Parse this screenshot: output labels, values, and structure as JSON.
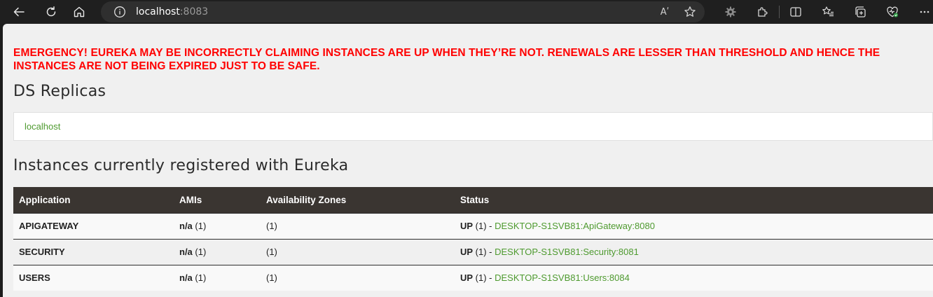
{
  "browser": {
    "url_host": "localhost",
    "url_port": ":8083",
    "read_aloud_icon": "Aʹ"
  },
  "page": {
    "warning": "EMERGENCY! EUREKA MAY BE INCORRECTLY CLAIMING INSTANCES ARE UP WHEN THEY’RE NOT. RENEWALS ARE LESSER THAN THRESHOLD AND HENCE THE INSTANCES ARE NOT BEING EXPIRED JUST TO BE SAFE.",
    "replicas_heading": "DS Replicas",
    "replica_link": "localhost",
    "instances_heading": "Instances currently registered with Eureka",
    "table": {
      "headers": [
        "Application",
        "AMIs",
        "Availability Zones",
        "Status"
      ],
      "rows": [
        {
          "app": "APIGATEWAY",
          "ami_bold": "n/a",
          "ami_count": " (1)",
          "zones": "(1)",
          "status_bold": "UP",
          "status_count": " (1) - ",
          "instance": "DESKTOP-S1SVB81:ApiGateway:8080"
        },
        {
          "app": "SECURITY",
          "ami_bold": "n/a",
          "ami_count": " (1)",
          "zones": "(1)",
          "status_bold": "UP",
          "status_count": " (1) - ",
          "instance": "DESKTOP-S1SVB81:Security:8081"
        },
        {
          "app": "USERS",
          "ami_bold": "n/a",
          "ami_count": " (1)",
          "zones": "(1)",
          "status_bold": "UP",
          "status_count": " (1) - ",
          "instance": "DESKTOP-S1SVB81:Users:8084"
        }
      ]
    }
  }
}
